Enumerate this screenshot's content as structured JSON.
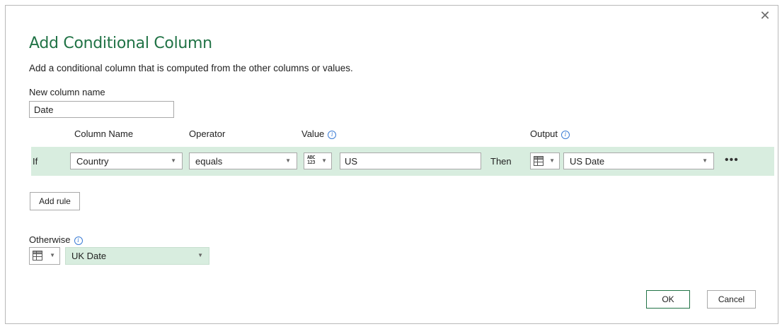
{
  "dialog": {
    "title": "Add Conditional Column",
    "subtitle": "Add a conditional column that is computed from the other columns or values.",
    "close_label": "✕"
  },
  "new_column": {
    "label": "New column name",
    "value": "Date"
  },
  "columns": {
    "column_name": "Column Name",
    "operator": "Operator",
    "value": "Value",
    "output": "Output"
  },
  "rule": {
    "if_label": "If",
    "column": "Country",
    "operator": "equals",
    "value_type": "ABC\n123",
    "value": "US",
    "then_label": "Then",
    "output": "US Date",
    "more_label": "•••"
  },
  "add_rule_label": "Add rule",
  "otherwise": {
    "label": "Otherwise",
    "value": "UK Date"
  },
  "footer": {
    "ok_label": "OK",
    "cancel_label": "Cancel"
  },
  "colors": {
    "accent": "#217346",
    "row_bg": "#d8eddf",
    "info_icon": "#3a7bd5"
  },
  "icons": {
    "info": "info-icon",
    "dropdown": "chevron-down-icon",
    "table": "table-icon",
    "type": "abc-123-type-icon",
    "close": "close-icon"
  }
}
